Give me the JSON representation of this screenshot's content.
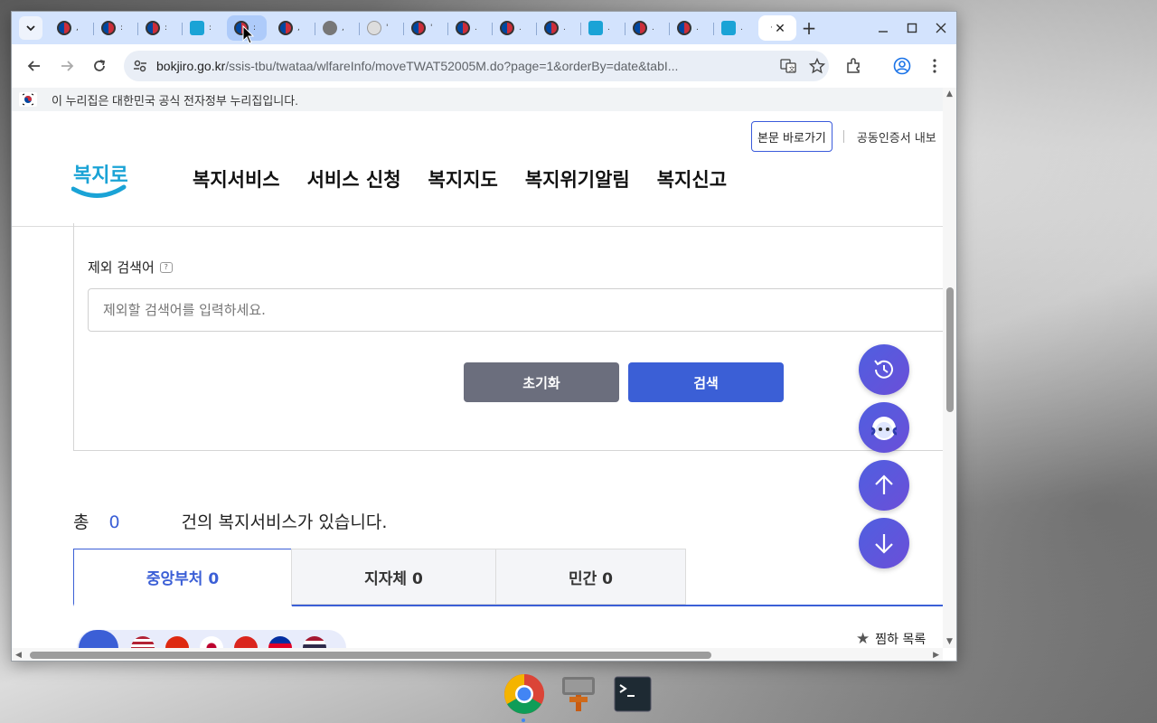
{
  "browser": {
    "url_host": "bokjiro.go.kr",
    "url_path": "/ssis-tbu/twataa/wlfareInfo/moveTWAT52005M.do?page=1&orderBy=date&tabI...",
    "active_tab_dots": "·"
  },
  "gov_banner": {
    "text": "이 누리집은 대한민국 공식 전자정부 누리집입니다."
  },
  "header": {
    "skip_label": "본문 바로가기",
    "cert_label": "공동인증서 내보",
    "logo_text": "복지로",
    "nav": [
      "복지서비스",
      "서비스 신청",
      "복지지도",
      "복지위기알림",
      "복지신고"
    ]
  },
  "search": {
    "exclude_label": "제외 검색어",
    "exclude_placeholder": "제외할 검색어를 입력하세요.",
    "reset_label": "초기화",
    "search_label": "검색"
  },
  "results": {
    "prefix": "총",
    "count": "0",
    "suffix": "건의 복지서비스가 있습니다.",
    "tabs": [
      "중앙부처 0",
      "지자체 0",
      "민간 0"
    ],
    "favorite_label": "찜하 목록"
  },
  "colors": {
    "accent": "#3b5fd6",
    "reset_button": "#6b6e7d",
    "tabstrip": "#d3e3fd"
  }
}
